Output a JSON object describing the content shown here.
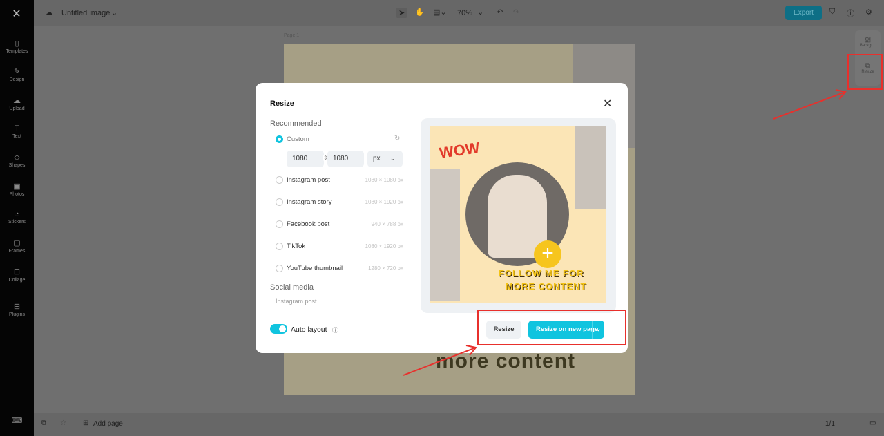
{
  "topbar": {
    "title": "Untitled image",
    "zoom": "70%",
    "export": "Export"
  },
  "sidebar": {
    "items": [
      "Templates",
      "Design",
      "Upload",
      "Text",
      "Shapes",
      "Photos",
      "Stickers",
      "Frames",
      "Collage",
      "Plugins"
    ]
  },
  "canvas": {
    "page_label": "Page 1",
    "big_text": "more content"
  },
  "right_panel": {
    "background": "Backgr...",
    "resize": "Resize"
  },
  "bottombar": {
    "add_page": "Add page",
    "page_count": "1/1"
  },
  "modal": {
    "title": "Resize",
    "recommended": "Recommended",
    "custom": {
      "label": "Custom",
      "width": "1080",
      "height": "1080",
      "unit": "px"
    },
    "options": [
      {
        "label": "Instagram post",
        "size": "1080 × 1080 px"
      },
      {
        "label": "Instagram story",
        "size": "1080 × 1920 px"
      },
      {
        "label": "Facebook post",
        "size": "940 × 788 px"
      },
      {
        "label": "TikTok",
        "size": "1080 × 1920 px"
      },
      {
        "label": "YouTube thumbnail",
        "size": "1280 × 720 px"
      }
    ],
    "social_media": "Social media",
    "social_item": "Instagram post",
    "auto_layout": "Auto layout",
    "resize_btn": "Resize",
    "resize_new_btn": "Resize on new page",
    "preview": {
      "wow": "WOW",
      "follow": "FOLLOW ME FOR",
      "more": "MORE CONTENT"
    }
  },
  "colors": {
    "accent": "#10c4df",
    "highlight": "#e8302c"
  }
}
